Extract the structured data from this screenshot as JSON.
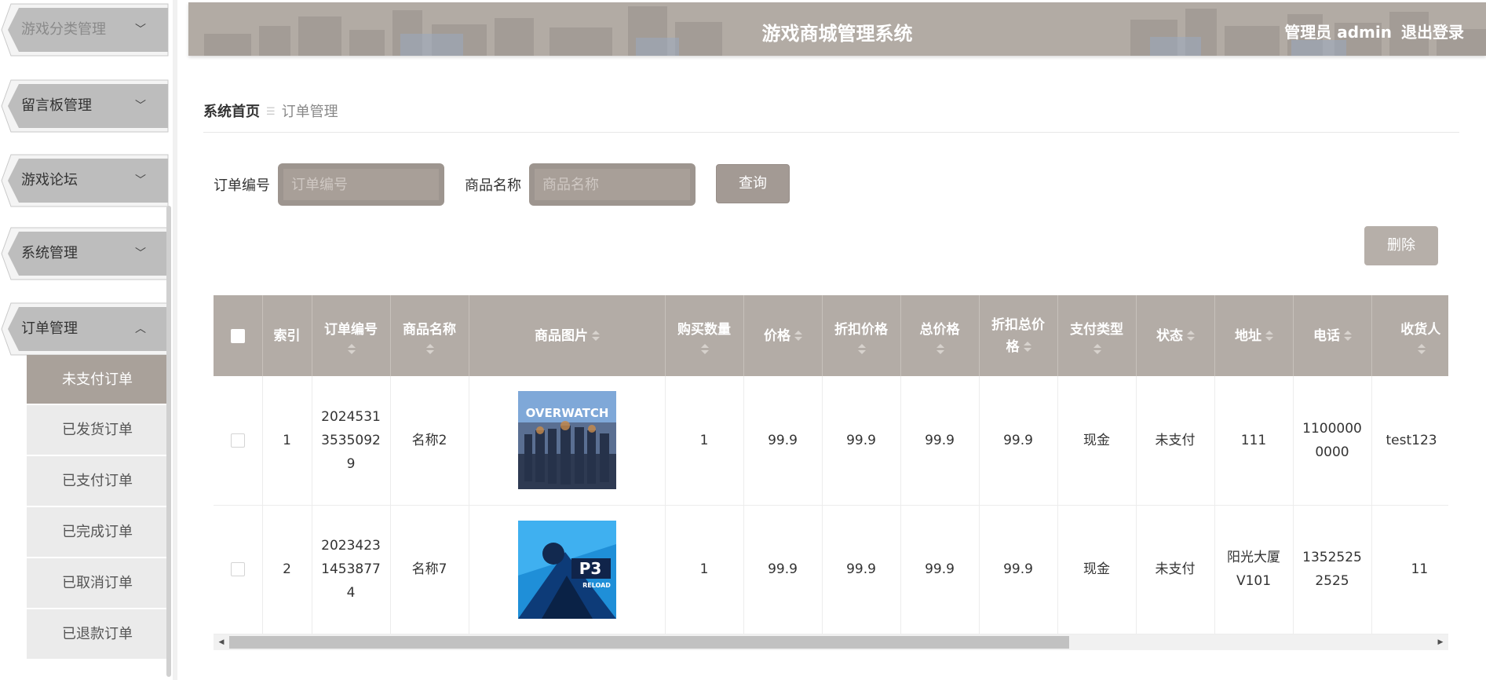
{
  "header": {
    "title": "游戏商城管理系统",
    "user_label": "管理员 admin",
    "logout_label": "退出登录"
  },
  "sidebar": {
    "menus": [
      {
        "label": "游戏分类管理",
        "chevron": "﹀"
      },
      {
        "label": "留言板管理",
        "chevron": "﹀"
      },
      {
        "label": "游戏论坛",
        "chevron": "﹀"
      },
      {
        "label": "系统管理",
        "chevron": "﹀"
      },
      {
        "label": "订单管理",
        "chevron": "︿"
      }
    ],
    "submenu": [
      "未支付订单",
      "已发货订单",
      "已支付订单",
      "已完成订单",
      "已取消订单",
      "已退款订单"
    ],
    "active_submenu": "未支付订单"
  },
  "breadcrumb": {
    "home": "系统首页",
    "current": "订单管理"
  },
  "search": {
    "order_no_label": "订单编号",
    "order_no_placeholder": "订单编号",
    "order_no_value": "",
    "product_label": "商品名称",
    "product_placeholder": "商品名称",
    "product_value": "",
    "query_button": "查询",
    "delete_button": "删除"
  },
  "table": {
    "columns": [
      "索引",
      "订单编号",
      "商品名称",
      "商品图片",
      "购买数量",
      "价格",
      "折扣价格",
      "总价格",
      "折扣总价格",
      "支付类型",
      "状态",
      "地址",
      "电话",
      "收货人"
    ],
    "rows": [
      {
        "index": "1",
        "order_no": "20245313535092​9",
        "order_no_lines": [
          "2024531",
          "3535092",
          "9"
        ],
        "product": "名称2",
        "image": "overwatch-cover",
        "qty": "1",
        "price": "99.9",
        "discount_price": "99.9",
        "total": "99.9",
        "discount_total": "99.9",
        "pay_type": "现金",
        "status": "未支付",
        "address_lines": [
          "111"
        ],
        "phone_lines": [
          "1100000",
          "0000"
        ],
        "receiver": "test123"
      },
      {
        "index": "2",
        "order_no_lines": [
          "2023423",
          "1453877",
          "4"
        ],
        "product": "名称7",
        "image": "persona3-reload-cover",
        "qty": "1",
        "price": "99.9",
        "discount_price": "99.9",
        "total": "99.9",
        "discount_total": "99.9",
        "pay_type": "现金",
        "status": "未支付",
        "address_lines": [
          "阳光大厦",
          "V101"
        ],
        "phone_lines": [
          "1352525",
          "2525"
        ],
        "receiver": "11"
      }
    ],
    "image_texts": {
      "overwatch": "OVERWATCH",
      "persona": "P3",
      "persona_sub": "RELOAD"
    }
  },
  "colors": {
    "accent": "#a9a19a",
    "header_bg": "#b2aba4",
    "table_header_bg": "#b3aca6"
  }
}
